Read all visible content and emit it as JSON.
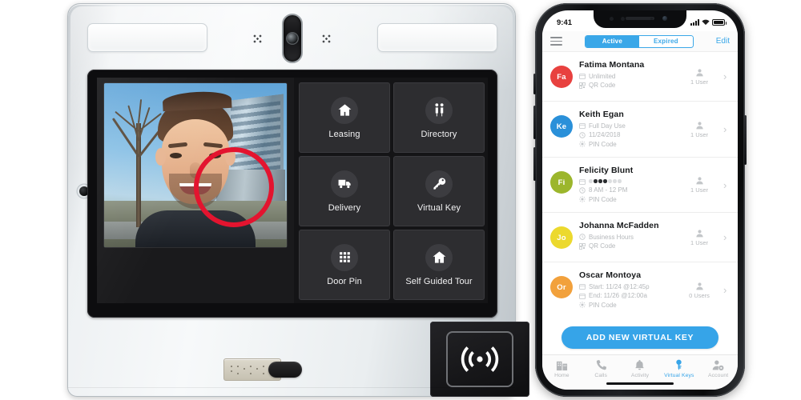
{
  "kiosk": {
    "device_name": "video-intercom-kiosk",
    "screen": {
      "video_pane_label": "Live video call feed",
      "tiles": [
        {
          "label": "Leasing",
          "icon": "house-icon"
        },
        {
          "label": "Directory",
          "icon": "people-icon"
        },
        {
          "label": "Delivery",
          "icon": "truck-icon"
        },
        {
          "label": "Virtual Key",
          "icon": "key-icon",
          "highlighted": true
        },
        {
          "label": "Door Pin",
          "icon": "keypad-grid-icon"
        },
        {
          "label": "Self Guided Tour",
          "icon": "house-icon"
        }
      ]
    },
    "hardware": {
      "camera_label": "camera-module",
      "light_left_label": "light-panel-left",
      "light_right_label": "light-panel-right",
      "braille_label": "braille-plate",
      "call_button_label": "call-button",
      "rfid_label": "rfid-reader"
    },
    "colors": {
      "highlight_ring": "#e3142f",
      "tile_bg": "#2d2d30",
      "screen_bg": "#141416"
    }
  },
  "phone": {
    "status_bar": {
      "time": "9:41",
      "signal": "signal-bars-icon",
      "wifi": "wifi-icon",
      "battery": "battery-icon"
    },
    "nav": {
      "menu_icon": "hamburger-menu-icon",
      "segments": [
        {
          "label": "Active",
          "selected": true
        },
        {
          "label": "Expired",
          "selected": false
        }
      ],
      "edit_label": "Edit"
    },
    "keys": [
      {
        "name": "Fatima Montana",
        "initials": "Fa",
        "color": "#e8413f",
        "details": [
          {
            "icon": "calendar-icon",
            "text": "Unlimited"
          },
          {
            "icon": "qr-icon",
            "text": "QR Code"
          }
        ],
        "users": "1 User"
      },
      {
        "name": "Keith Egan",
        "initials": "Ke",
        "color": "#2a90d9",
        "details": [
          {
            "icon": "calendar-icon",
            "text": "Full Day Use"
          },
          {
            "icon": "clock-icon",
            "text": "11/24/2018"
          },
          {
            "icon": "pin-icon",
            "text": "PIN Code"
          }
        ],
        "users": "1 User"
      },
      {
        "name": "Felicity Blunt",
        "initials": "Fi",
        "color": "#9cb62c",
        "details": [
          {
            "icon": "calendar-icon",
            "text": "",
            "weekdays": [
              false,
              true,
              true,
              true,
              false,
              false,
              false
            ]
          },
          {
            "icon": "clock-icon",
            "text": "8 AM - 12 PM"
          },
          {
            "icon": "pin-icon",
            "text": "PIN Code"
          }
        ],
        "users": "1 User"
      },
      {
        "name": "Johanna McFadden",
        "initials": "Jo",
        "color": "#ecd92e",
        "details": [
          {
            "icon": "clock-icon",
            "text": "Business Hours"
          },
          {
            "icon": "qr-icon",
            "text": "QR Code"
          }
        ],
        "users": "1 User"
      },
      {
        "name": "Oscar Montoya",
        "initials": "Or",
        "color": "#f2a13c",
        "details": [
          {
            "icon": "calendar-icon",
            "text": "Start: 11/24 @12:45p"
          },
          {
            "icon": "calendar-icon",
            "text": "End: 11/26 @12:00a"
          },
          {
            "icon": "pin-icon",
            "text": "PIN Code"
          }
        ],
        "users": "0 Users"
      }
    ],
    "add_button_label": "ADD NEW VIRTUAL KEY",
    "tabs": [
      {
        "label": "Home",
        "icon": "building-icon",
        "active": false
      },
      {
        "label": "Calls",
        "icon": "phone-icon",
        "active": false
      },
      {
        "label": "Activity",
        "icon": "bell-icon",
        "active": false
      },
      {
        "label": "Virtual Keys",
        "icon": "key-icon",
        "active": true
      },
      {
        "label": "Account",
        "icon": "account-gear-icon",
        "active": false
      }
    ],
    "colors": {
      "accent": "#36a4e8",
      "muted_text": "#b4b7ba",
      "name_text": "#16181a"
    }
  }
}
